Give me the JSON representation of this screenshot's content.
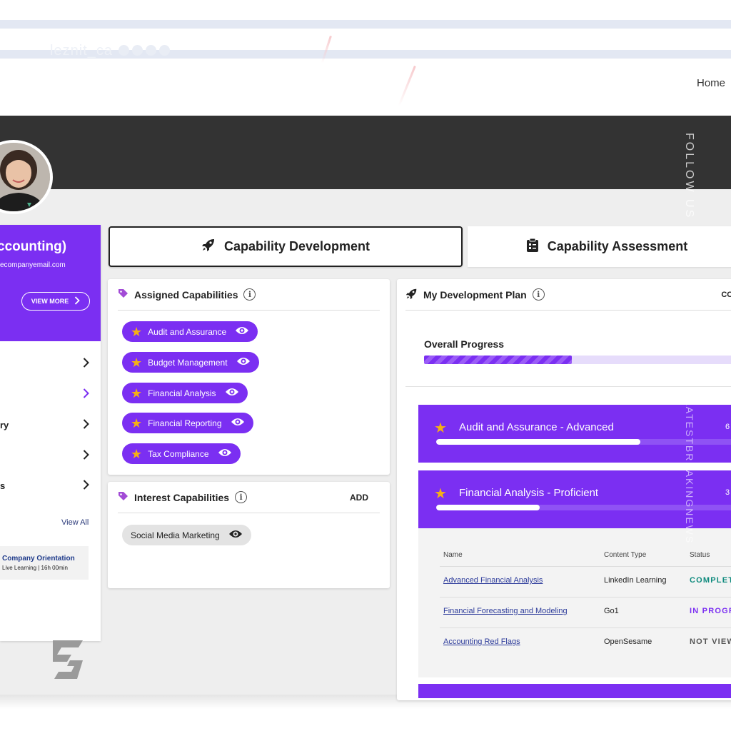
{
  "topbar": {
    "brand_text": "leznit_ca",
    "home_label": "Home"
  },
  "profile": {
    "name": "ccounting)",
    "email": "ecompanyemail.com",
    "view_more_label": "VIEW MORE"
  },
  "sidebar": {
    "items": [
      {
        "label": ""
      },
      {
        "label": ""
      },
      {
        "label": "ry"
      },
      {
        "label": ""
      },
      {
        "label": "s"
      }
    ],
    "view_all_label": "View All",
    "course": {
      "title": "Company Orientation",
      "meta": "Live Learning | 16h 00min"
    }
  },
  "tabs": [
    {
      "label": "Capability Development",
      "icon": "rocket-icon",
      "active": true
    },
    {
      "label": "Capability Assessment",
      "icon": "clipboard-icon",
      "active": false
    }
  ],
  "assigned": {
    "title": "Assigned Capabilities",
    "items": [
      "Audit and Assurance",
      "Budget Management",
      "Financial Analysis",
      "Financial Reporting",
      "Tax Compliance"
    ]
  },
  "interest": {
    "title": "Interest Capabilities",
    "add_label": "ADD",
    "items": [
      "Social Media Marketing"
    ]
  },
  "plan": {
    "title": "My Development Plan",
    "header_action": "COM",
    "overall_label": "Overall Progress",
    "overall_progress": 0.47,
    "capabilities": [
      {
        "title": "Audit and Assurance - Advanced",
        "pct_text": "6",
        "progress": 0.65
      },
      {
        "title": "Financial Analysis - Proficient",
        "pct_text": "3",
        "progress": 0.33
      }
    ],
    "table": {
      "headers": [
        "Name",
        "Content Type",
        "Status"
      ],
      "rows": [
        {
          "name": "Advanced Financial Analysis",
          "type": "LinkedIn Learning",
          "status": "COMPLET",
          "status_color": "#0e8a7d"
        },
        {
          "name": "Financial Forecasting and Modeling",
          "type": "Go1",
          "status": "IN PROGR",
          "status_color": "#7b2ff2"
        },
        {
          "name": "Accounting Red Flags",
          "type": "OpenSesame",
          "status": "NOT VIEW",
          "status_color": "#555555"
        }
      ]
    }
  },
  "overlay": {
    "follow_text": "FOLLOW US",
    "latest_text": "LATESTBREAKINGNEWS"
  },
  "colors": {
    "accent": "#7b2ff2",
    "star": "#f5b014",
    "banner": "#333333"
  }
}
